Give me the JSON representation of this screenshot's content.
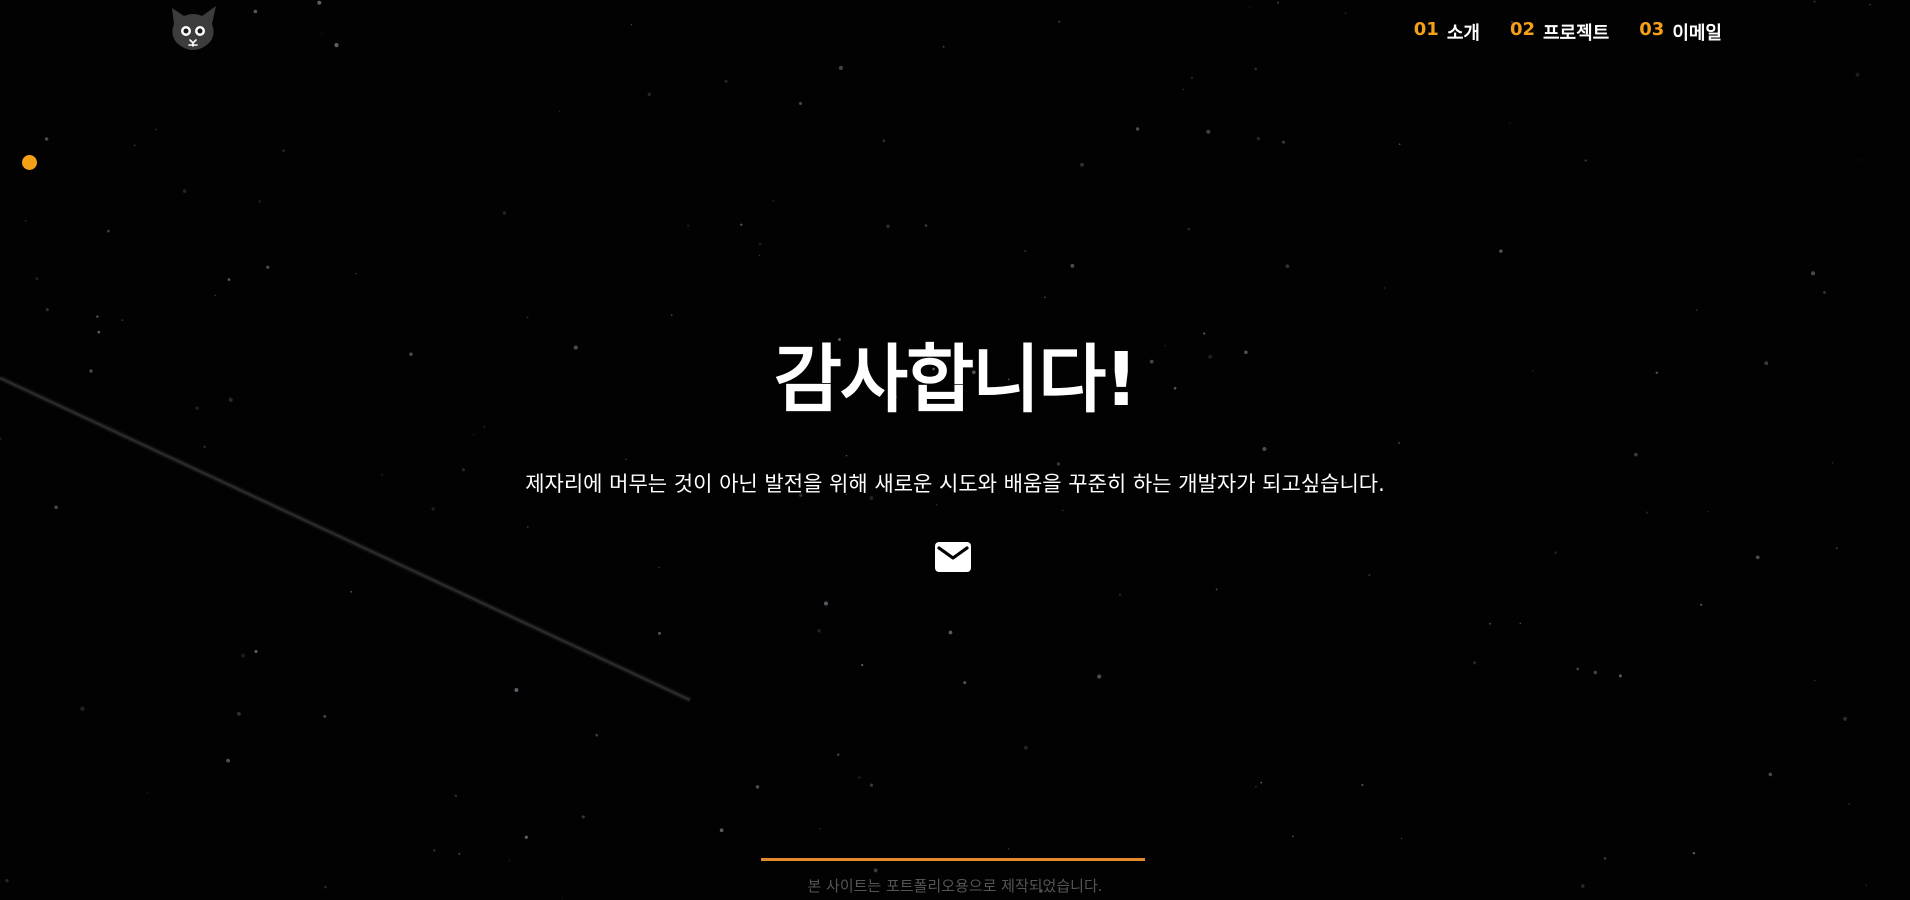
{
  "header": {
    "logo_icon": "cat-face-icon",
    "nav": [
      {
        "num": "01",
        "label": "소개"
      },
      {
        "num": "02",
        "label": "프로젝트"
      },
      {
        "num": "03",
        "label": "이메일"
      }
    ]
  },
  "side_indicator": {
    "icon": "dot-indicator"
  },
  "hero": {
    "title": "감사합니다!",
    "subtitle": "제자리에 머무는 것이 아닌 발전을 위해 새로운 시도와 배움을 꾸준히 하는 개발자가 되고싶습니다.",
    "mail_icon": "mail-icon"
  },
  "footer": {
    "text": "본 사이트는 포트폴리오용으로 제작되었습니다."
  },
  "colors": {
    "accent": "#f5a016",
    "background": "#020203",
    "footer_line": "#e38b2c"
  }
}
